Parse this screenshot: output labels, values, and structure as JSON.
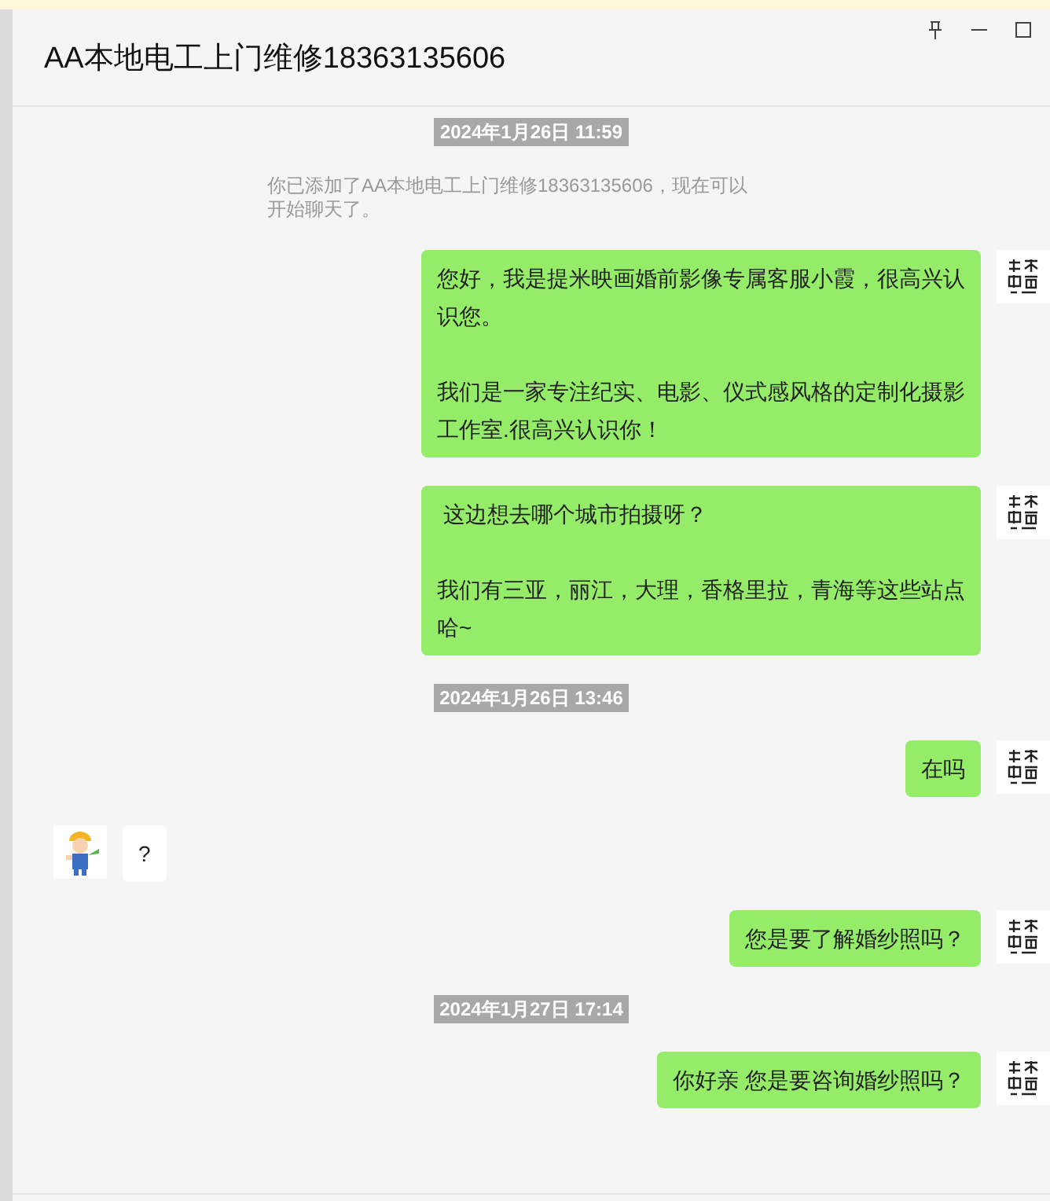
{
  "window": {
    "title": "AA本地电工上门维修18363135606"
  },
  "messages": [
    {
      "kind": "time",
      "text": "2024年1月26日 11:59"
    },
    {
      "kind": "system",
      "text": "你已添加了AA本地电工上门维修18363135606，现在可以开始聊天了。"
    },
    {
      "kind": "sent",
      "paragraphs": [
        "您好，我是提米映画婚前影像专属客服小霞，很高兴认识您。",
        "我们是一家专注纪实、电影、仪式感风格的定制化摄影工作室.很高兴认识你！"
      ]
    },
    {
      "kind": "sent",
      "paragraphs": [
        " 这边想去哪个城市拍摄呀？",
        "我们有三亚，丽江，大理，香格里拉，青海等这些站点哈~"
      ]
    },
    {
      "kind": "time",
      "text": "2024年1月26日 13:46"
    },
    {
      "kind": "sent",
      "paragraphs": [
        "在吗"
      ]
    },
    {
      "kind": "received",
      "paragraphs": [
        "?"
      ]
    },
    {
      "kind": "sent",
      "paragraphs": [
        "您是要了解婚纱照吗？"
      ]
    },
    {
      "kind": "time",
      "text": "2024年1月27日 17:14"
    },
    {
      "kind": "sent",
      "paragraphs": [
        "你好亲 您是要咨询婚纱照吗？"
      ]
    }
  ]
}
